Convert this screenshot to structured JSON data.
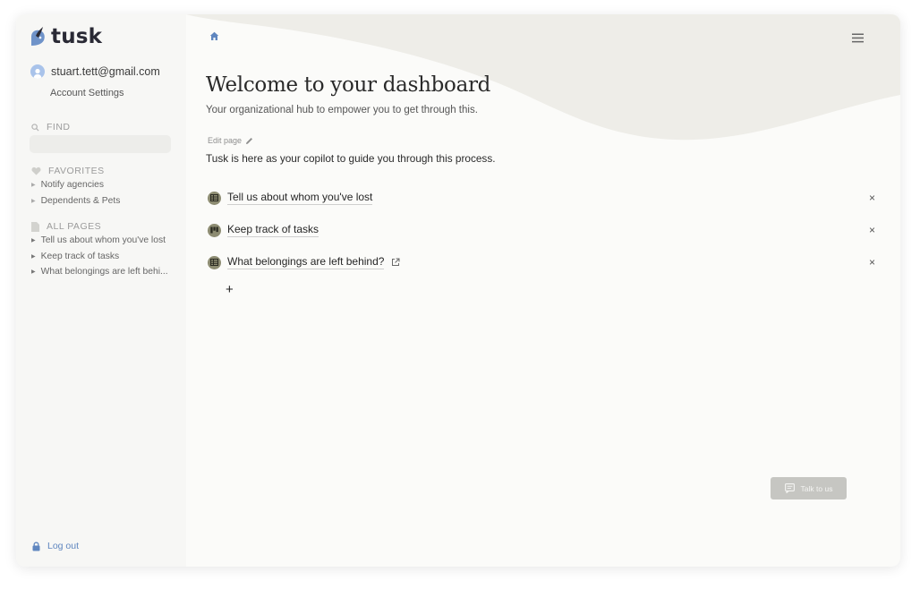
{
  "app": {
    "name": "tusk",
    "logo_icon": "tusk-logo-icon"
  },
  "user": {
    "email": "stuart.tett@gmail.com",
    "account_settings": "Account Settings"
  },
  "sidebar": {
    "find_label": "FIND",
    "favorites_label": "FAVORITES",
    "favorites": [
      "Notify agencies",
      "Dependents & Pets"
    ],
    "all_pages_label": "ALL PAGES",
    "all_pages": [
      "Tell us about whom you've lost",
      "Keep track of tasks",
      "What belongings are left behi..."
    ],
    "logout": "Log out"
  },
  "main": {
    "title": "Welcome to your dashboard",
    "subtitle": "Your organizational hub to empower you to get through this.",
    "edit_page": "Edit page",
    "intro": "Tusk is here as your copilot to guide you through this process.",
    "page_links": [
      {
        "label": "Tell us about whom you've lost",
        "icon": "table-icon"
      },
      {
        "label": "Keep track of tasks",
        "icon": "board-icon"
      },
      {
        "label": "What belongings are left behind?",
        "icon": "table-icon",
        "external": true
      }
    ],
    "remove_symbol": "×",
    "add_symbol": "+"
  },
  "talk_button": {
    "label": "Talk to us"
  },
  "colors": {
    "sidebar_bg": "#f7f7f5",
    "main_bg": "#fbfbf9",
    "wave": "#eeede8",
    "accent_blue": "#5f86bf",
    "page_icon_bg": "#8d8c72",
    "talk_button_bg": "#c6c6c2"
  }
}
